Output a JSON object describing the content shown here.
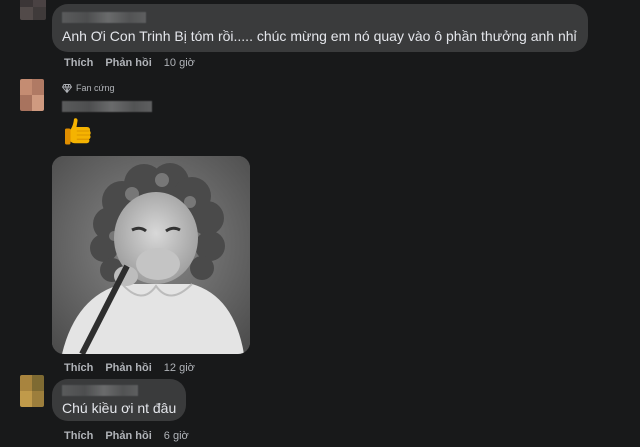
{
  "comments": [
    {
      "text": "Anh Ơi Con Trinh Bị tóm rồi..... chúc mừng em nó quay vào ô phần thưởng anh nhỉ",
      "actions": {
        "like": "Thích",
        "reply": "Phản hồi",
        "time": "10 giờ"
      }
    },
    {
      "badge": "Fan cứng",
      "emoji": "thumbs-up",
      "image": "black-and-white-crying-child-photo",
      "actions": {
        "like": "Thích",
        "reply": "Phản hồi",
        "time": "12 giờ"
      }
    },
    {
      "text": "Chú kiều ơi nt đâu",
      "actions": {
        "like": "Thích",
        "reply": "Phản hồi",
        "time": "6 giờ"
      }
    }
  ],
  "colors": {
    "background": "#18191a",
    "bubble": "#3a3b3c",
    "text": "#e4e6eb",
    "secondary_text": "#b0b3b8"
  }
}
